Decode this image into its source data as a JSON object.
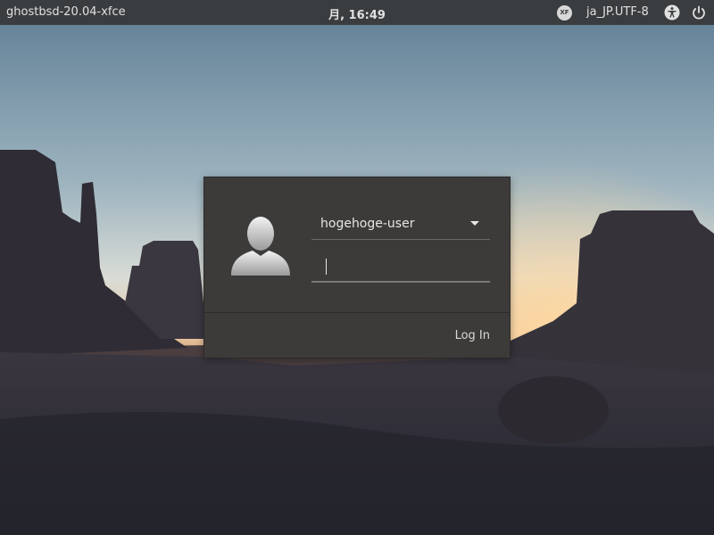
{
  "panel": {
    "host_label": "ghostbsd-20.04-xfce",
    "clock": "月, 16:49",
    "keyboard_badge": "XF",
    "language": "ja_JP.UTF-8"
  },
  "login": {
    "username": "hogehoge-user",
    "password_value": "",
    "login_label": "Log In"
  },
  "colors": {
    "panel_bg": "#3a3d40",
    "dialog_bg": "#3c3b3a",
    "text": "#e6e6e6"
  },
  "icons": {
    "keyboard_layout": "xf-badge-icon",
    "accessibility": "accessibility-icon",
    "power": "power-icon",
    "avatar": "user-avatar-icon",
    "dropdown": "dropdown-arrow-icon"
  }
}
